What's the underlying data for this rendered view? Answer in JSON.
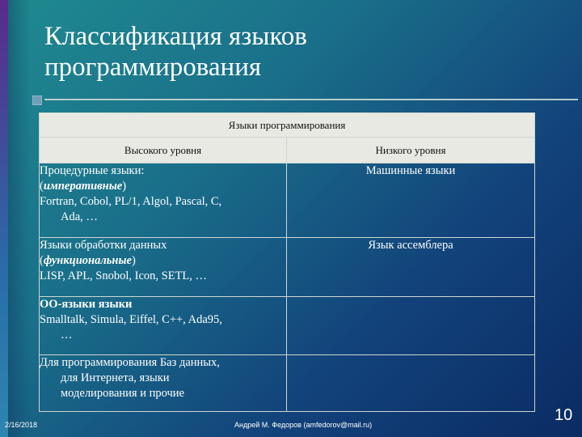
{
  "slide": {
    "title_line1": "Классификация языков",
    "title_line2": "программирования",
    "date": "2/16/2018",
    "footer": "Андрей М. Федоров (amfedorov@mail.ru)",
    "page_number": "10"
  },
  "table": {
    "header": "Языки программирования",
    "col_high": "Высокого уровня",
    "col_low": "Низкого уровня",
    "rows": [
      {
        "high_line1": "Процедурные языки:",
        "high_open": "(",
        "high_italic": "императивные",
        "high_close": ")",
        "high_line3": "Fortran, Cobol, PL/1, Algol, Pascal, C,",
        "high_line4": "Ada, …",
        "low": "Машинные языки"
      },
      {
        "high_line1": "Языки обработки данных",
        "high_open": "(",
        "high_italic": "функциональные",
        "high_close": ")",
        "high_line3": "LISP, APL, Snobol, Icon, SETL, …",
        "low": "Язык ассемблера"
      },
      {
        "high_bold": "ОО-языки языки",
        "high_line2": "Smalltalk, Simula, Eiffel, C++, Ada95,",
        "high_line3": "…",
        "low": ""
      },
      {
        "high_line1": "Для программирования Баз данных,",
        "high_line2": "для Интернета, языки",
        "high_line3": "моделирования и прочие",
        "low": ""
      }
    ]
  }
}
